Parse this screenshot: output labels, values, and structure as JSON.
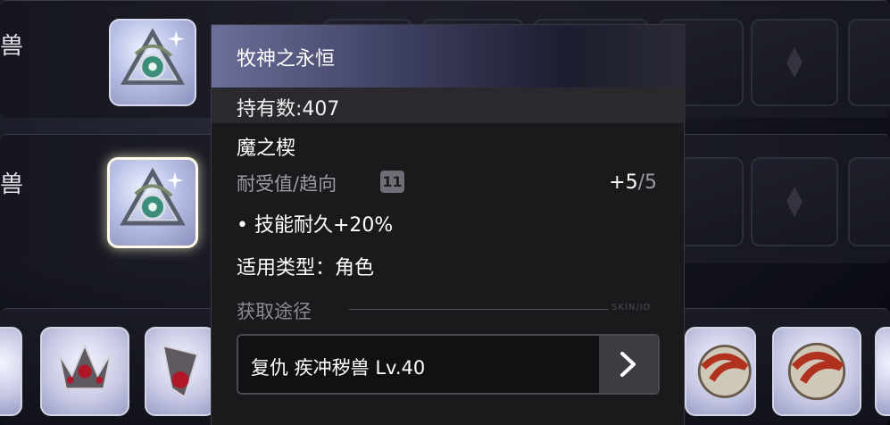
{
  "rows": [
    {
      "label": "兽"
    },
    {
      "label": "兽"
    }
  ],
  "tooltip": {
    "title": "牧神之永恒",
    "owned": "持有数:407",
    "category": "魔之楔",
    "durability_label": "耐受值/趋向",
    "durability_badge": "11",
    "durability_current": "+5",
    "durability_sep_max": "/5",
    "effect": "• 技能耐久+20%",
    "applicable_type": "适用类型：角色",
    "source_label": "获取途径",
    "source_mark": "SKIN/ID",
    "source_entry": "复仇 疾冲秽兽 Lv.40"
  },
  "icons": {
    "item_icon": "pan-eternity-emblem-icon",
    "arrow": "chevron-right-icon",
    "empty_slot": "diamond-icon"
  },
  "colors": {
    "tooltip_bg": "#1a1a1d",
    "header_gradient_start": "#6c6f9a",
    "muted_text": "#9a9aa2"
  }
}
